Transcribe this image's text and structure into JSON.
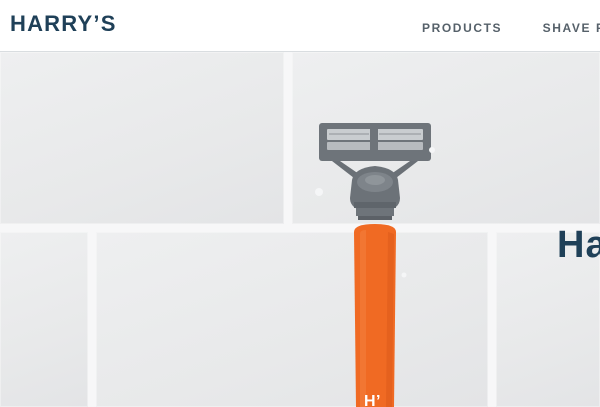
{
  "header": {
    "logo": "HARRY’S",
    "nav": [
      {
        "label": "PRODUCTS"
      },
      {
        "label": "SHAVE PLAN"
      }
    ]
  },
  "hero": {
    "heading": "Ha",
    "product_mark": "H’"
  },
  "colors": {
    "brand_navy": "#1f4058",
    "nav_gray": "#56616a",
    "razor_orange": "#f06a23",
    "cartridge_gray": "#6e747a",
    "tile": "#e9eaeb"
  }
}
